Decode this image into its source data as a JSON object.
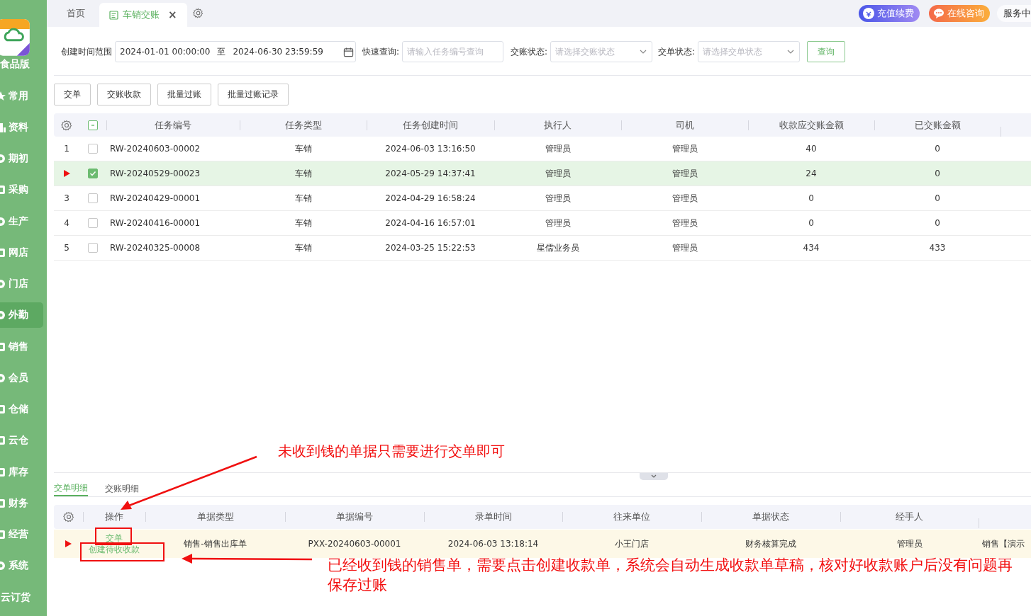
{
  "sidebar": {
    "edition": "食品版",
    "items": [
      {
        "label": "常用",
        "kind": "star",
        "selected": false
      },
      {
        "label": "资料",
        "kind": "bars",
        "selected": false
      },
      {
        "label": "期初",
        "kind": "circle",
        "selected": false
      },
      {
        "label": "采购",
        "kind": "square",
        "selected": false
      },
      {
        "label": "生产",
        "kind": "circle",
        "selected": false
      },
      {
        "label": "网店",
        "kind": "square",
        "selected": false
      },
      {
        "label": "门店",
        "kind": "circle",
        "selected": false
      },
      {
        "label": "外勤",
        "kind": "circle",
        "selected": true
      },
      {
        "label": "销售",
        "kind": "square",
        "selected": false
      },
      {
        "label": "会员",
        "kind": "circle",
        "selected": false
      },
      {
        "label": "仓储",
        "kind": "square",
        "selected": false
      },
      {
        "label": "云仓",
        "kind": "square",
        "selected": false
      },
      {
        "label": "库存",
        "kind": "square",
        "selected": false
      },
      {
        "label": "财务",
        "kind": "square",
        "selected": false
      },
      {
        "label": "经营",
        "kind": "square",
        "selected": false
      },
      {
        "label": "系统",
        "kind": "circle",
        "selected": false
      },
      {
        "label": "云订货",
        "kind": "none",
        "selected": false
      }
    ]
  },
  "tabs": [
    {
      "label": "首页",
      "selected": false
    },
    {
      "label": "车销交账",
      "selected": true,
      "close": "×"
    }
  ],
  "header_buttons": [
    {
      "label": "充值续费",
      "kind": "recharge"
    },
    {
      "label": "在线咨询",
      "kind": "chat"
    },
    {
      "label": "服务中",
      "kind": "plain"
    }
  ],
  "filters": {
    "date_range": {
      "label": "创建时间范围",
      "start": "2024-01-01 00:00:00",
      "separator": "至",
      "end": "2024-06-30 23:59:59"
    },
    "quick_search": {
      "label": "快速查询:",
      "placeholder": "请输入任务编号查询"
    },
    "selects": [
      {
        "label": "交账状态:",
        "placeholder": "请选择交账状态"
      },
      {
        "label": "交单状态:",
        "placeholder": "请选择交单状态"
      }
    ],
    "query_button": "查询"
  },
  "actions": [
    "交单",
    "交账收款",
    "批量过账",
    "批量过账记录"
  ],
  "tasks": {
    "select_all_indeterminate": true,
    "columns": [
      "任务编号",
      "任务类型",
      "任务创建时间",
      "执行人",
      "司机",
      "收款应交账金额",
      "已交账金额"
    ],
    "rows": [
      {
        "number": "1",
        "current": false,
        "checked": false,
        "cells": [
          "RW-20240603-00002",
          "车销",
          "2024-06-03 13:16:50",
          "管理员",
          "管理员",
          "40",
          "0"
        ]
      },
      {
        "current": true,
        "checked": true,
        "cells": [
          "RW-20240529-00023",
          "车销",
          "2024-05-29 14:37:41",
          "管理员",
          "管理员",
          "24",
          "0"
        ]
      },
      {
        "number": "3",
        "current": false,
        "checked": false,
        "cells": [
          "RW-20240429-00001",
          "车销",
          "2024-04-29 16:58:24",
          "管理员",
          "管理员",
          "0",
          "0"
        ]
      },
      {
        "number": "4",
        "current": false,
        "checked": false,
        "cells": [
          "RW-20240416-00001",
          "车销",
          "2024-04-16 16:57:01",
          "管理员",
          "管理员",
          "0",
          "0"
        ]
      },
      {
        "number": "5",
        "current": false,
        "checked": false,
        "cells": [
          "RW-20240325-00008",
          "车销",
          "2024-03-25 15:22:53",
          "星儒业务员",
          "管理员",
          "434",
          "433"
        ]
      }
    ]
  },
  "detail": {
    "tabs": [
      {
        "label": "交单明细",
        "selected": true
      },
      {
        "label": "交账明细",
        "selected": false
      }
    ],
    "action_header": "操作",
    "columns": [
      "单据类型",
      "单据编号",
      "录单时间",
      "往来单位",
      "单据状态",
      "经手人"
    ],
    "rows": [
      {
        "current": true,
        "actions": [
          "交单",
          "创建待收收款"
        ],
        "cells": [
          "销售-销售出库单",
          "PXX-20240603-00001",
          "2024-06-03 13:18:14",
          "小王门店",
          "财务核算完成",
          "管理员",
          "销售【演示"
        ]
      }
    ]
  },
  "annotations": [
    {
      "text": "未收到钱的单据只需要进行交单即可"
    },
    {
      "text": "已经收到钱的销售单，需要点击创建收款单，系统会自动生成收款单草稿，核对好收款账户后没有问题再保存过账"
    }
  ]
}
